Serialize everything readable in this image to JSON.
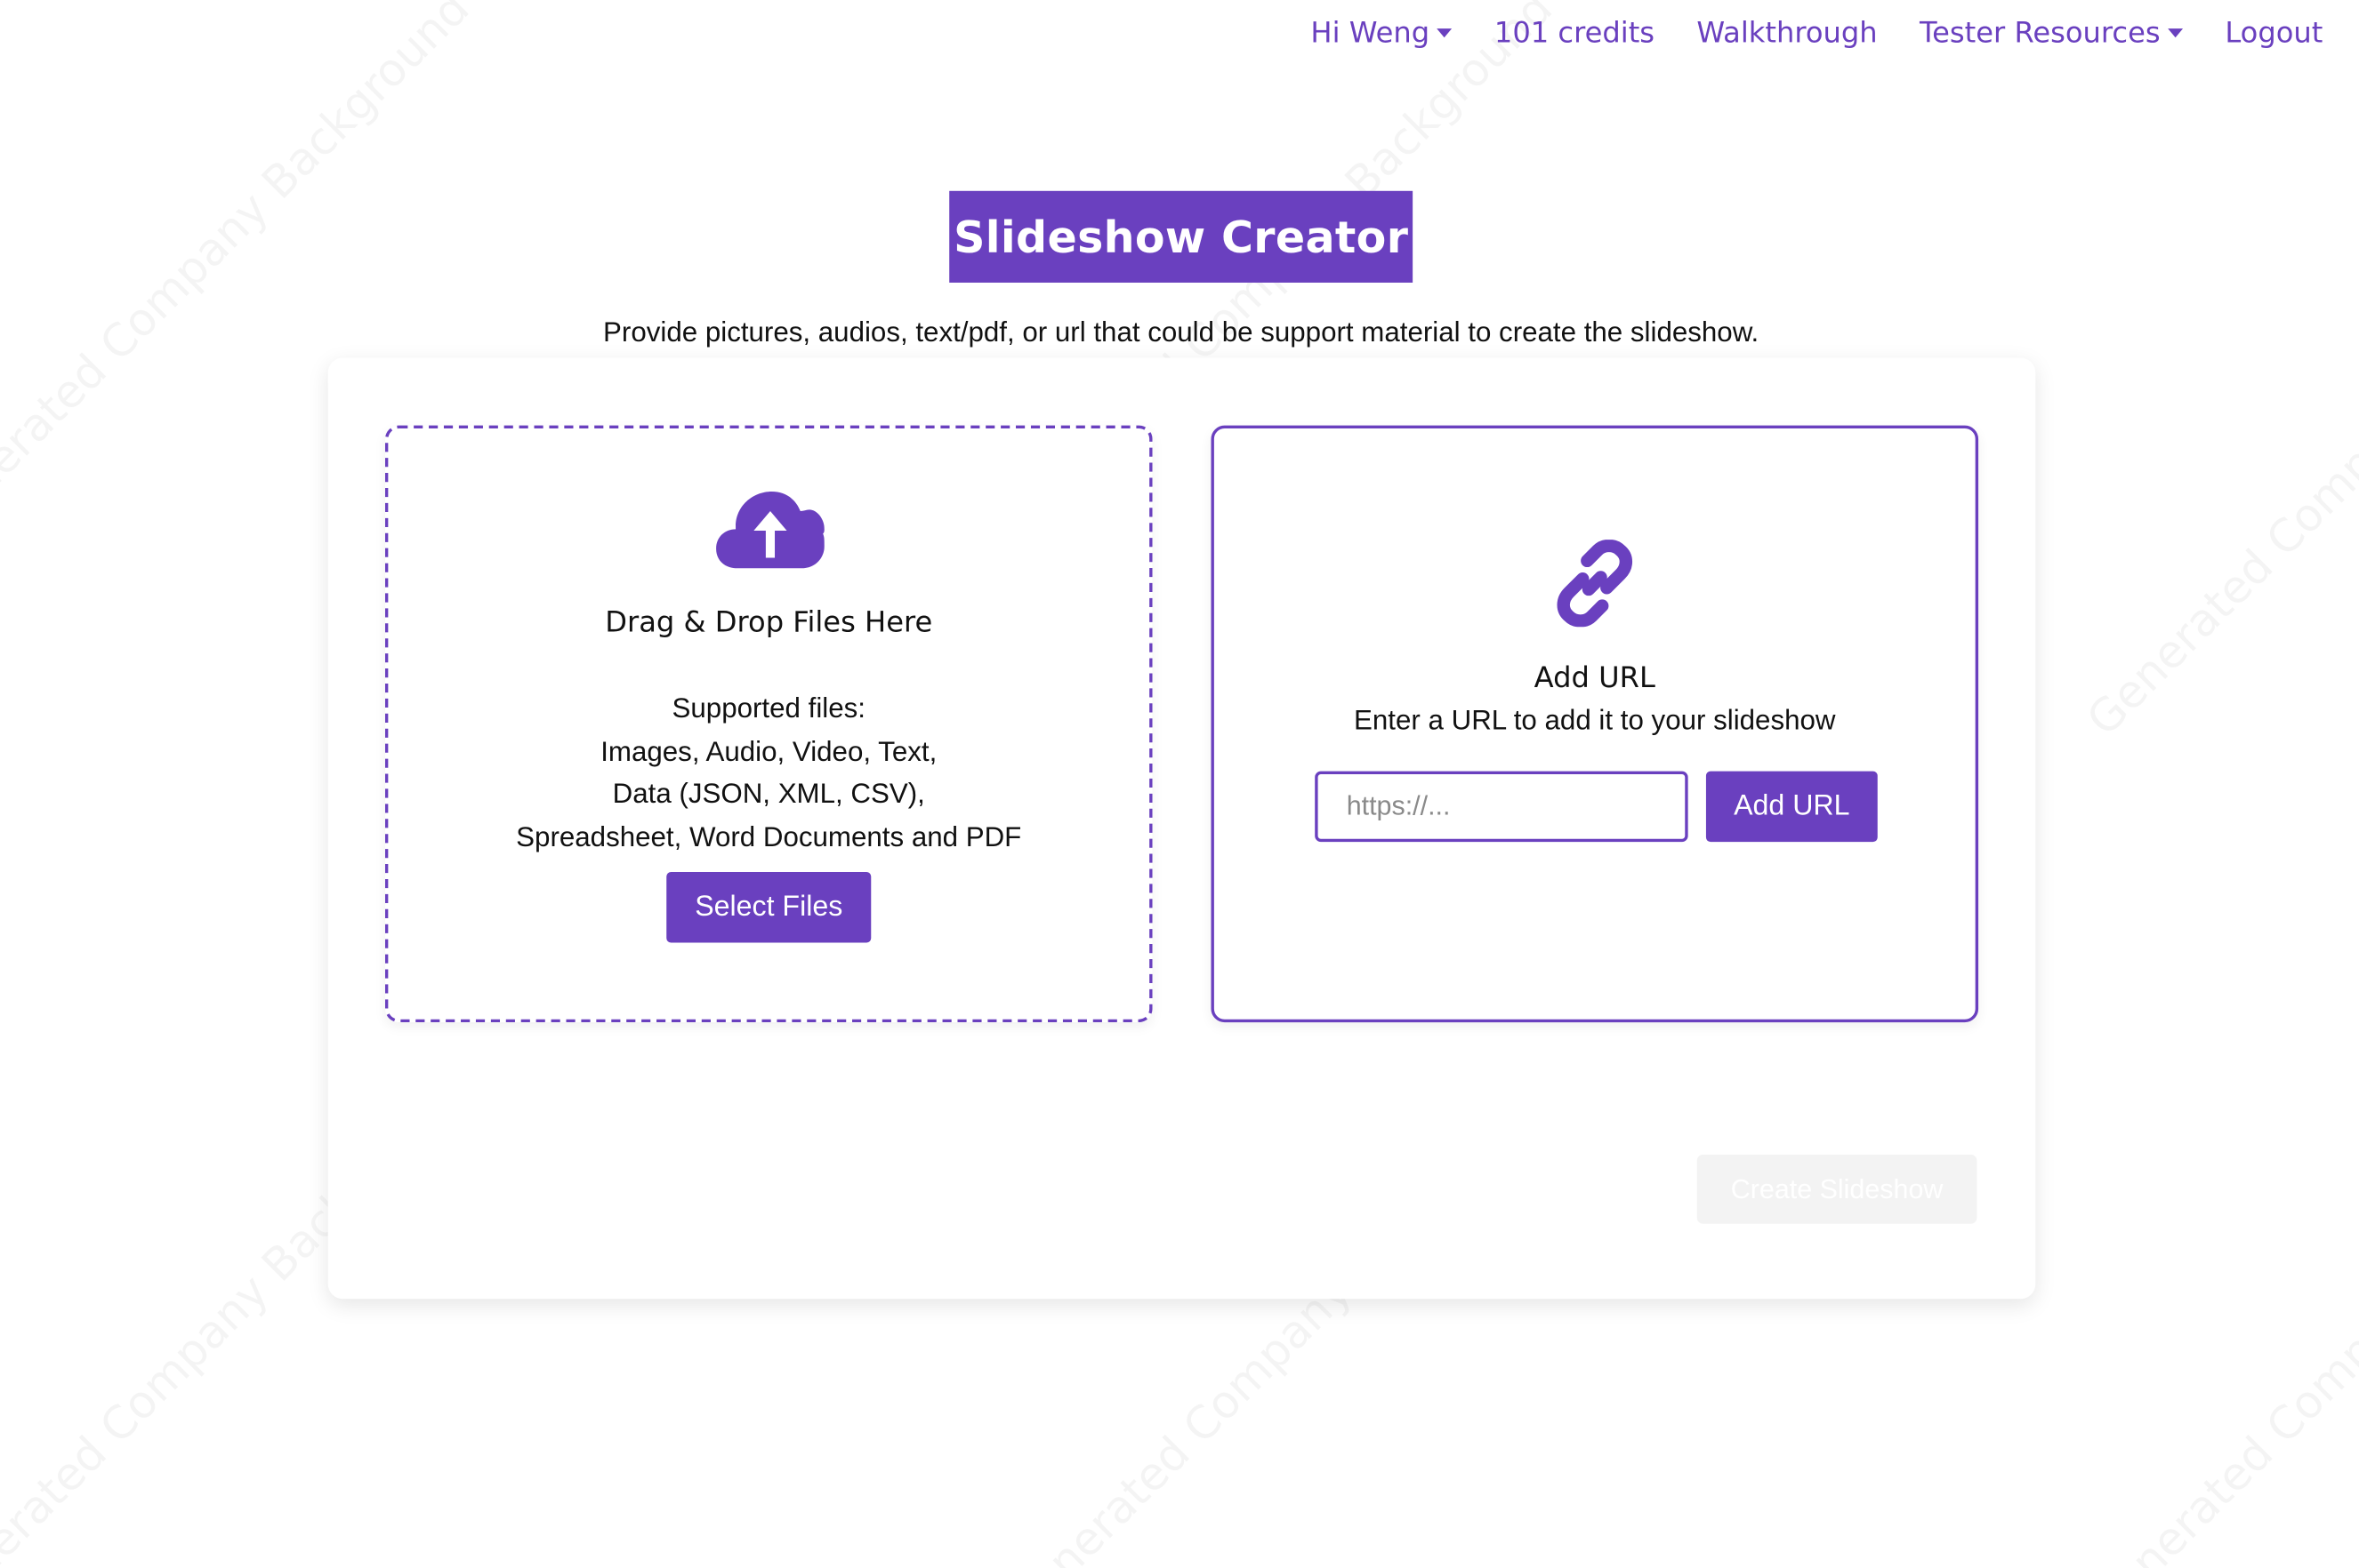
{
  "nav": {
    "greeting": "Hi Weng",
    "credits": "101 credits",
    "walkthrough": "Walkthrough",
    "tester_resources": "Tester Resources",
    "logout": "Logout"
  },
  "header": {
    "title": "Slideshow Creator",
    "subtitle": "Provide pictures, audios, text/pdf, or url that could be support material to create the slideshow."
  },
  "dropzone": {
    "title": "Drag & Drop Files Here",
    "supported_lines": [
      "Supported files:",
      "Images, Audio, Video, Text,",
      "Data (JSON, XML, CSV),",
      "Spreadsheet, Word Documents and PDF"
    ],
    "select_button": "Select Files",
    "icon": "cloud-upload-icon"
  },
  "url_panel": {
    "title": "Add URL",
    "description": "Enter a URL to add it to your slideshow",
    "input_placeholder": "https://...",
    "input_value": "",
    "add_button": "Add URL",
    "icon": "link-icon"
  },
  "footer": {
    "create_button": "Create Slideshow"
  },
  "watermark_text": "Generated Company Background",
  "colors": {
    "accent": "#6a40bf",
    "disabled_bg": "#f3f3f3"
  }
}
